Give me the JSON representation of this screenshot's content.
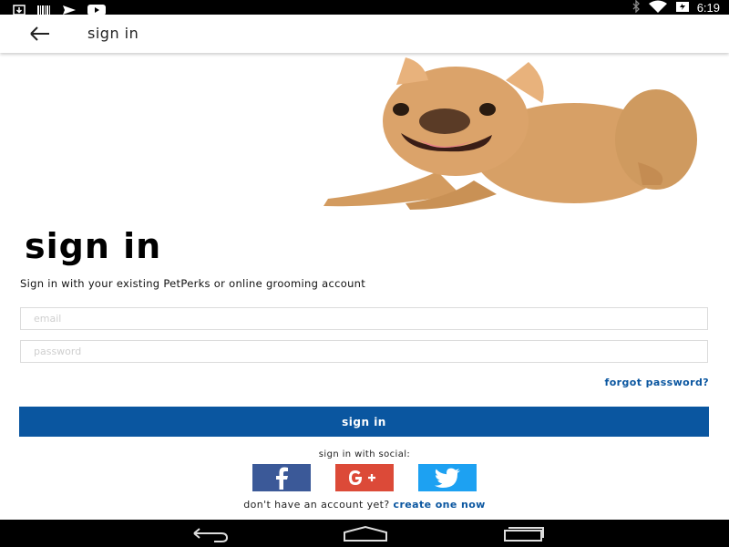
{
  "status_bar": {
    "time": "6:19",
    "left_icons": [
      "download-icon",
      "barcode-icon",
      "send-icon",
      "youtube-icon"
    ],
    "right_icons": [
      "bluetooth-icon",
      "wifi-icon",
      "battery-icon"
    ]
  },
  "app_bar": {
    "title": "sign in",
    "back_icon": "arrow-back-icon"
  },
  "main": {
    "heading": "sign in",
    "subtext": "Sign in with your existing PetPerks or online grooming account",
    "email_placeholder": "email",
    "password_placeholder": "password",
    "forgot_password": "forgot password?",
    "signin_button": "sign in",
    "social_label": "sign in with social:",
    "social_buttons": [
      {
        "name": "facebook",
        "glyph": "f",
        "color": "#3b5998"
      },
      {
        "name": "google-plus",
        "glyph": "G+",
        "color": "#dc4a38"
      },
      {
        "name": "twitter",
        "glyph": "twitter-bird",
        "color": "#1da1f2"
      }
    ],
    "signup_prompt": "don't have an account yet?",
    "signup_link": "create one now"
  },
  "colors": {
    "accent": "#0a56a0"
  },
  "nav_bar": {
    "buttons": [
      "back-nav-icon",
      "home-nav-icon",
      "recents-nav-icon"
    ]
  }
}
